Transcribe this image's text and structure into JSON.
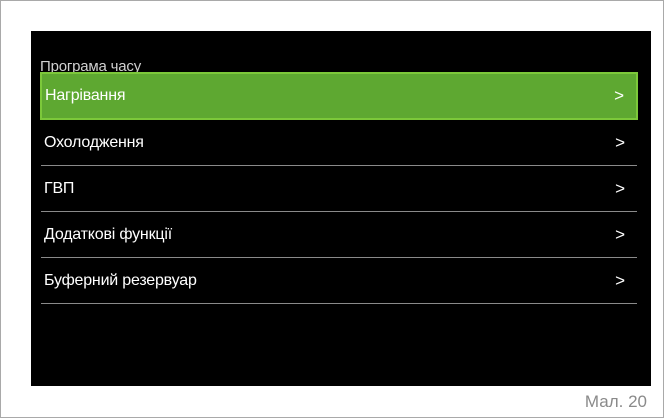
{
  "screen": {
    "title": "Програма часу",
    "items": [
      {
        "label": "Нагрівання",
        "arrow": ">",
        "selected": true
      },
      {
        "label": "Охолодження",
        "arrow": ">",
        "selected": false
      },
      {
        "label": "ГВП",
        "arrow": ">",
        "selected": false
      },
      {
        "label": "Додаткові функції",
        "arrow": ">",
        "selected": false
      },
      {
        "label": "Буферний резервуар",
        "arrow": ">",
        "selected": false
      }
    ],
    "selected_color": "#5ea831",
    "background_color": "#000000"
  },
  "caption": "Мал. 20"
}
